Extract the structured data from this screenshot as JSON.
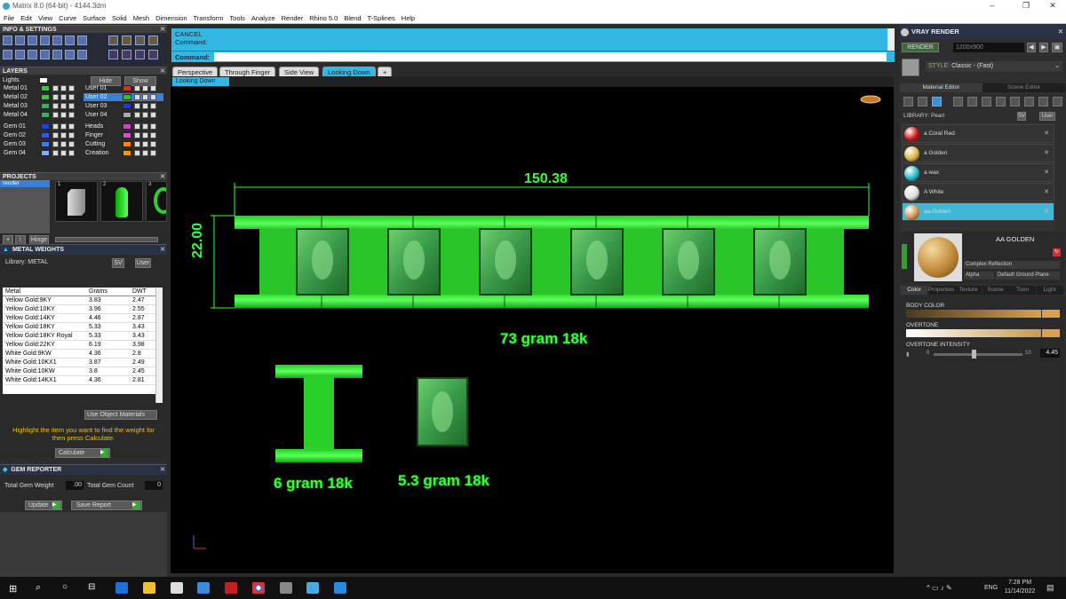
{
  "window": {
    "title": "Matrix 8.0 (64-bit) - 4144.3dm",
    "minimize": "–",
    "restore": "❐",
    "close": "✕"
  },
  "menu": [
    "File",
    "Edit",
    "View",
    "Curve",
    "Surface",
    "Solid",
    "Mesh",
    "Dimension",
    "Transform",
    "Tools",
    "Analyze",
    "Render",
    "Rhino 5.0",
    "Blend",
    "T-Splines",
    "Help"
  ],
  "info_settings": {
    "title": "INFO & SETTINGS"
  },
  "layers": {
    "title": "LAYERS",
    "lights": "Lights",
    "hide": "Hide",
    "show": "Show",
    "left": [
      {
        "name": "Metal 01",
        "color": "#33cc33"
      },
      {
        "name": "Metal 02",
        "color": "#33cc33"
      },
      {
        "name": "Metal 03",
        "color": "#22bb55"
      },
      {
        "name": "Metal 04",
        "color": "#22bb55"
      },
      {
        "name": "Gem 01",
        "color": "#2244dd"
      },
      {
        "name": "Gem 02",
        "color": "#3355ee"
      },
      {
        "name": "Gem 03",
        "color": "#4477ee"
      },
      {
        "name": "Gem 04",
        "color": "#88aaff"
      }
    ],
    "right": [
      {
        "name": "User 01",
        "color": "#ee2222"
      },
      {
        "name": "User 02",
        "color": "#22cc22",
        "selected": true
      },
      {
        "name": "User 03",
        "color": "#2233ee"
      },
      {
        "name": "User 04",
        "color": "#aaaaaa"
      },
      {
        "name": "Heads",
        "color": "#cc44cc"
      },
      {
        "name": "Finger",
        "color": "#cc55cc"
      },
      {
        "name": "Cutting",
        "color": "#ff8800"
      },
      {
        "name": "Creation",
        "color": "#ff9900"
      }
    ]
  },
  "projects": {
    "title": "PROJECTS",
    "item": "render",
    "thumbs": [
      "1",
      "2",
      "3"
    ],
    "hinge": "Hinge"
  },
  "metal_weights": {
    "title": "METAL WEIGHTS",
    "library": "Library: METAL",
    "sv": "SV",
    "user": "User",
    "headers": [
      "Metal",
      "Grams",
      "DWT"
    ],
    "rows": [
      [
        "Yellow Gold:9KY",
        "3.83",
        "2.47"
      ],
      [
        "Yellow Gold:10KY",
        "3.96",
        "2.55"
      ],
      [
        "Yellow Gold:14KY",
        "4.46",
        "2.87"
      ],
      [
        "Yellow Gold:18KY",
        "5.33",
        "3.43"
      ],
      [
        "Yellow Gold:18KY Royal",
        "5.33",
        "3.43"
      ],
      [
        "Yellow Gold:22KY",
        "6.19",
        "3.98"
      ],
      [
        "White Gold:9KW",
        "4.36",
        "2.8"
      ],
      [
        "White Gold:10KX1",
        "3.87",
        "2.49"
      ],
      [
        "White Gold:10KW",
        "3.8",
        "2.45"
      ],
      [
        "White Gold:14KX1",
        "4.36",
        "2.81"
      ]
    ],
    "use_object": "Use Object Materials",
    "hint": "Highlight the item you want to find the weight for then press Calculate.",
    "calculate": "Calculate"
  },
  "gem_reporter": {
    "title": "GEM REPORTER",
    "total_weight_label": "Total Gem Weight",
    "total_weight": ".00",
    "total_count_label": "Total Gem Count",
    "total_count": "0",
    "update": "Update",
    "save_report": "Save Report"
  },
  "command": {
    "line1": "CANCEL",
    "line2": "Command:",
    "prompt": "Command:"
  },
  "viewport_tabs": [
    "Perspective",
    "Through Finger",
    "Side View",
    "Looking Down"
  ],
  "active_viewport": "Looking Down",
  "viewport": {
    "dim_width": "150.38",
    "dim_height": "22.00",
    "label_bracelet": "73 gram 18k",
    "label_link": "6 gram 18k",
    "label_pendant": "5.3 gram 18k"
  },
  "vray": {
    "title": "VRAY RENDER",
    "render": "RENDER",
    "resolution": "1200x900",
    "style_label": "STYLE:",
    "style_value": "Classic - (Fast)",
    "tabs": [
      "Material Editor",
      "Scene Editor"
    ],
    "library": "LIBRARY: Pearl",
    "sv": "SV",
    "user": "User",
    "materials": [
      {
        "name": "a Coral Red",
        "color": "#cc1111"
      },
      {
        "name": "a Golden",
        "color": "#d9b440"
      },
      {
        "name": "a wax",
        "color": "#22bbcc"
      },
      {
        "name": "A White",
        "color": "#dddddd"
      },
      {
        "name": "aa Golden",
        "color": "#d4904a",
        "selected": true
      }
    ],
    "preview_name": "AA  GOLDEN",
    "reflection": "Complex Reflection",
    "alpha": "Alpha",
    "ground": "Default Ground Plane",
    "sub_tabs": [
      "Color",
      "Properties",
      "Texture",
      "Scene",
      "Toon",
      "Light"
    ],
    "body_color": "BODY COLOR",
    "overtone": "OVERTONE",
    "overtone_intensity": "OVERTONE INTENSITY",
    "slider_min": "0",
    "slider_max": "10",
    "intensity_value": "4.45"
  },
  "taskbar": {
    "time": "7:28 PM",
    "date": "11/14/2022",
    "lang": "ENG"
  }
}
